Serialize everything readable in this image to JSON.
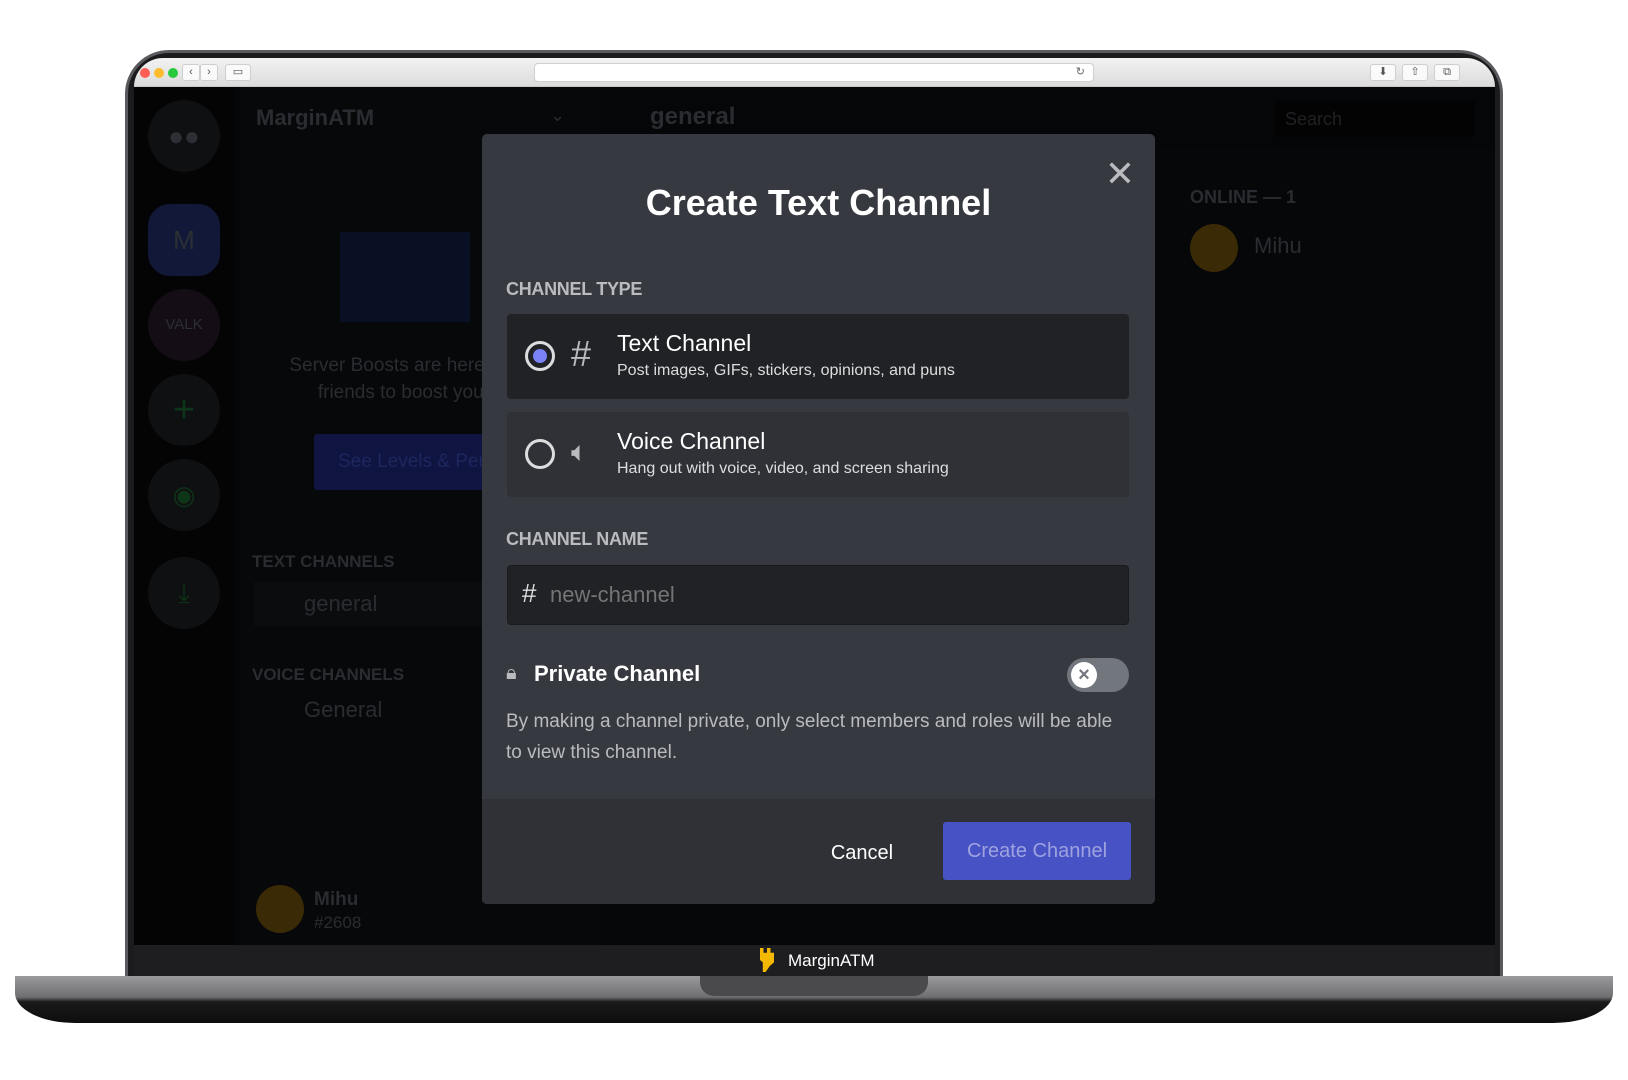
{
  "browser": {
    "back": "‹",
    "forward": "›",
    "refresh": "↻"
  },
  "app": {
    "server_name": "MarginATM",
    "rail": {
      "m_label": "M",
      "valk_label": "VALK",
      "add": "+"
    },
    "boost": {
      "line1": "Server Boosts are here!",
      "line2": "friends to boost your",
      "button": "See Levels & Per"
    },
    "categories": [
      {
        "label": "TEXT CHANNELS",
        "channel": "general"
      },
      {
        "label": "VOICE CHANNELS",
        "channel": "General"
      }
    ],
    "user": {
      "name": "Mihu",
      "tag": "#2608"
    },
    "header": {
      "channel": "general",
      "search_placeholder": "Search"
    },
    "members": {
      "heading": "ONLINE — 1",
      "member": "Mihu"
    }
  },
  "modal": {
    "title": "Create Text Channel",
    "channel_type_label": "CHANNEL TYPE",
    "options": [
      {
        "name": "Text Channel",
        "desc": "Post images, GIFs, stickers, opinions, and puns",
        "icon": "hash-icon",
        "selected": true
      },
      {
        "name": "Voice Channel",
        "desc": "Hang out with voice, video, and screen sharing",
        "icon": "speaker-icon",
        "selected": false
      }
    ],
    "channel_name_label": "CHANNEL NAME",
    "channel_name_placeholder": "new-channel",
    "channel_name_value": "",
    "private_label": "Private Channel",
    "private_enabled": false,
    "private_desc": "By making a channel private, only select members and roles will be able to view this channel.",
    "cancel": "Cancel",
    "create": "Create Channel"
  },
  "laptop": {
    "brand": "MarginATM"
  },
  "colors": {
    "accent": "#5865f2",
    "button": "#4752c4",
    "radio": "#7983f5",
    "modal_bg": "#36393f",
    "brand_yellow": "#f5b800"
  }
}
